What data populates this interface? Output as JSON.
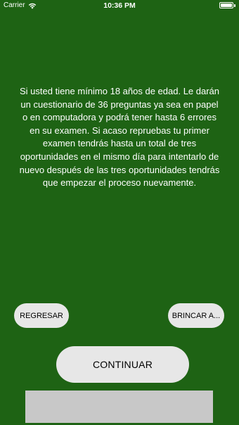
{
  "status_bar": {
    "carrier": "Carrier",
    "time": "10:36 PM",
    "wifi_icon": "wifi-icon",
    "battery_icon": "battery-icon"
  },
  "info_text": "Si usted tiene mínimo 18 años de edad. Le darán un cuestionario de 36 preguntas ya sea en papel o en computadora y podrá tener hasta 6 errores en su examen. Si acaso repruebas tu primer examen tendrás hasta un total de tres oportunidades en el mismo día para intentarlo de nuevo después de las tres oportunidades tendrás que empezar el proceso nuevamente.",
  "buttons": {
    "back_label": "REGRESAR",
    "skip_label": "BRINCAR A...",
    "continue_label": "CONTINUAR"
  },
  "colors": {
    "background": "#1e6314",
    "button": "#e7e7e7",
    "bottom_panel": "#c8c8c8",
    "text": "#ffffff"
  }
}
